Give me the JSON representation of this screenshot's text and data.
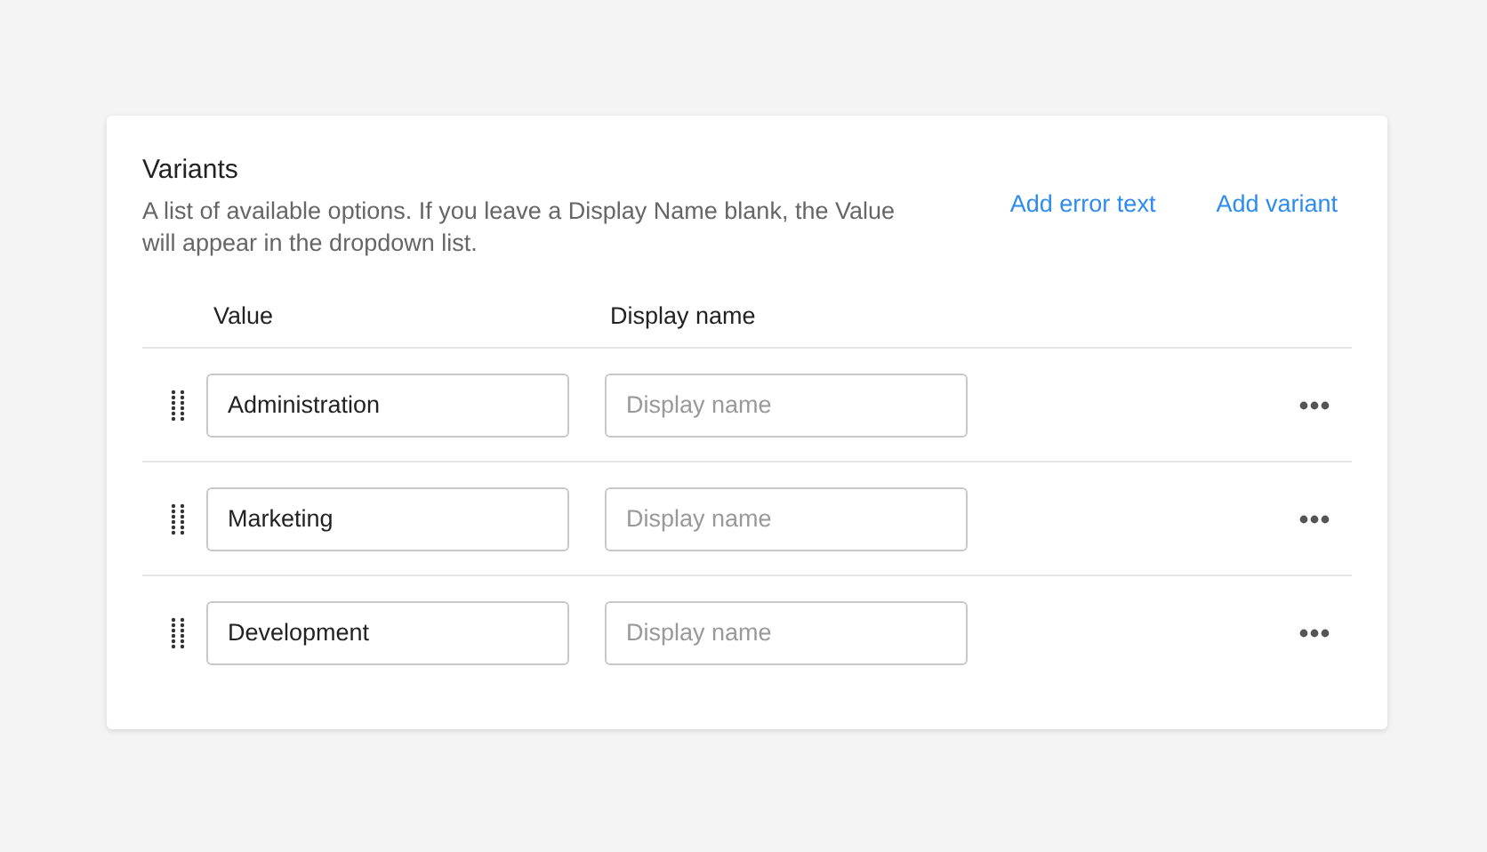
{
  "card": {
    "title": "Variants",
    "description": "A list of available options. If you leave a Display Name blank, the Value will appear in the dropdown list.",
    "actions": [
      "Add error text",
      "Add variant"
    ]
  },
  "columns": [
    "Value",
    "Display name"
  ],
  "rows": [
    {
      "value": "Administration",
      "display_placeholder": "Display name"
    },
    {
      "value": "Marketing",
      "display_placeholder": "Display name"
    },
    {
      "value": "Development",
      "display_placeholder": "Display name"
    }
  ]
}
